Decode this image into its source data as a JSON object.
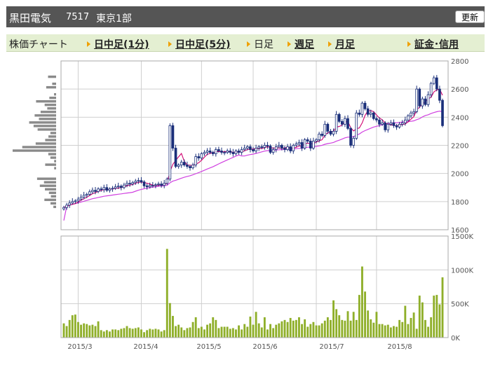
{
  "header": {
    "company": "黒田電気",
    "code": "7517",
    "market": "東京1部",
    "refresh_label": "更新"
  },
  "nav": {
    "chart_label": "株価チャート",
    "items": [
      {
        "label": "日中足(1分)",
        "link": true
      },
      {
        "label": "日中足(5分)",
        "link": true
      },
      {
        "label": "日足",
        "link": false
      },
      {
        "label": "週足",
        "link": true
      },
      {
        "label": "月足",
        "link": true
      },
      {
        "label": "証金･信用",
        "link": true
      }
    ]
  },
  "colors": {
    "candle": "#1a2f7a",
    "ma_short": "#d0006f",
    "ma_long": "#d040e0",
    "volume": "#8faf2a",
    "volume_profile": "#8a8a8a",
    "grid": "#cfcfcf"
  },
  "chart_data": [
    {
      "type": "candlestick",
      "ylim": [
        1600,
        2800
      ],
      "ytick_labels": [
        "2800",
        "2600",
        "2400",
        "2200",
        "2000",
        "1800",
        "1600"
      ],
      "xtick_labels": [
        "2015/3",
        "2015/4",
        "2015/5",
        "2015/6",
        "2015/7",
        "2015/8"
      ],
      "series": [
        {
          "values": [
            1758,
            1775,
            1790,
            1800,
            1805,
            1818,
            1832,
            1845,
            1852,
            1870,
            1880,
            1872,
            1890,
            1885,
            1900,
            1880,
            1890,
            1895,
            1905,
            1910,
            1900,
            1918,
            1930,
            1925,
            1935,
            1945,
            1950,
            1940,
            1912,
            1905,
            1915,
            1915,
            1920,
            1925,
            1915,
            1930,
            1960,
            2340,
            2180,
            2050,
            2060,
            2080,
            2060,
            2050,
            2040,
            2060,
            2120,
            2110,
            2140,
            2150,
            2160,
            2150,
            2140,
            2170,
            2160,
            2150,
            2150,
            2160,
            2150,
            2140,
            2160,
            2150,
            2170,
            2180,
            2190,
            2170,
            2160,
            2180,
            2190,
            2185,
            2200,
            2195,
            2150,
            2170,
            2190,
            2200,
            2180,
            2170,
            2190,
            2160,
            2200,
            2210,
            2220,
            2180,
            2240,
            2230,
            2180,
            2230,
            2240,
            2280,
            2270,
            2350,
            2300,
            2280,
            2300,
            2420,
            2370,
            2350,
            2390,
            2320,
            2200,
            2250,
            2430,
            2420,
            2500,
            2460,
            2420,
            2430,
            2390,
            2380,
            2350,
            2360,
            2310,
            2350,
            2360,
            2340,
            2330,
            2350,
            2360,
            2380,
            2410,
            2430,
            2440,
            2600,
            2480,
            2530,
            2490,
            2560,
            2640,
            2680,
            2600,
            2520,
            2340
          ]
        }
      ]
    },
    {
      "type": "bar",
      "ylim": [
        0,
        1500
      ],
      "ytick_labels": [
        "1500K",
        "1000K",
        "500K",
        "0K"
      ],
      "series": [
        {
          "values": [
            210,
            170,
            260,
            330,
            340,
            230,
            190,
            210,
            200,
            180,
            190,
            170,
            240,
            110,
            90,
            110,
            90,
            120,
            120,
            110,
            130,
            140,
            170,
            140,
            130,
            140,
            150,
            120,
            80,
            110,
            130,
            120,
            130,
            120,
            90,
            110,
            1310,
            510,
            320,
            170,
            190,
            150,
            110,
            140,
            150,
            230,
            300,
            140,
            160,
            120,
            190,
            210,
            300,
            260,
            140,
            160,
            160,
            160,
            130,
            140,
            120,
            180,
            120,
            200,
            160,
            310,
            190,
            380,
            210,
            150,
            300,
            120,
            200,
            140,
            190,
            210,
            240,
            260,
            230,
            290,
            250,
            260,
            300,
            200,
            270,
            160,
            200,
            230,
            180,
            180,
            210,
            250,
            300,
            260,
            550,
            420,
            330,
            260,
            250,
            390,
            250,
            380,
            260,
            630,
            1050,
            680,
            400,
            270,
            220,
            380,
            200,
            200,
            180,
            190,
            150,
            170,
            160,
            260,
            230,
            470,
            200,
            290,
            370,
            130,
            620,
            520,
            260,
            160,
            300,
            620,
            630,
            490,
            890
          ]
        }
      ]
    }
  ]
}
